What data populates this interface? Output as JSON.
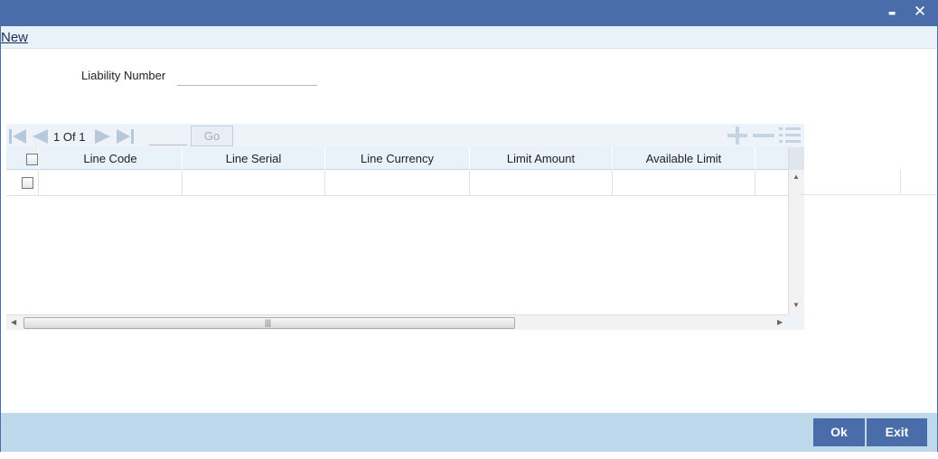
{
  "window": {
    "minimize_glyph": "▬",
    "close_glyph": "✕"
  },
  "menu": {
    "new_label": "New"
  },
  "form": {
    "liability_number_label": "Liability Number",
    "liability_number_value": ""
  },
  "grid": {
    "pagination": {
      "current": "1",
      "of_label": "Of",
      "total": "1",
      "page_input_value": "",
      "go_label": "Go"
    },
    "columns": [
      "Line Code",
      "Line Serial",
      "Line Currency",
      "Limit Amount",
      "Available Limit"
    ],
    "rows": [
      {
        "line_code": "",
        "line_serial": "",
        "line_currency": "",
        "limit_amount": "",
        "available_limit": ""
      }
    ],
    "scroll_grip": "|||"
  },
  "footer": {
    "ok_label": "Ok",
    "exit_label": "Exit"
  },
  "colors": {
    "titlebar": "#4a6da9",
    "footer": "#bed9ec",
    "header_row": "#e9f1f9",
    "button": "#4a6da9"
  },
  "icons": [
    "minimize-icon",
    "close-icon",
    "first-page-icon",
    "previous-page-icon",
    "next-page-icon",
    "last-page-icon",
    "add-row-icon",
    "delete-row-icon",
    "single-view-icon"
  ]
}
